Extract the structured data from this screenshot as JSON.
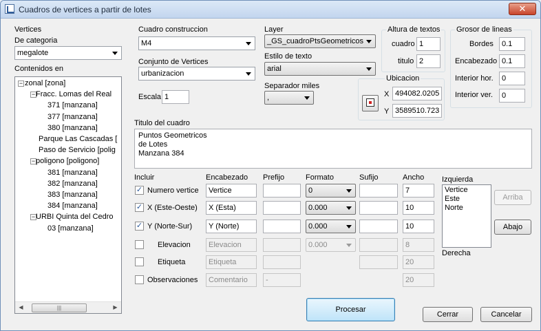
{
  "window": {
    "title": "Cuadros de vertices a partir de lotes",
    "close": "✕"
  },
  "vertices": {
    "group": "Vertices",
    "category_label": "De categoria",
    "category_value": "megalote",
    "contents_label": "Contenidos en",
    "tree": [
      {
        "text": "zonal [zona]",
        "exp": "−"
      },
      {
        "text": "Fracc. Lomas del Real",
        "exp": "−"
      },
      {
        "text": "371 [manzana]"
      },
      {
        "text": "377 [manzana]"
      },
      {
        "text": "380 [manzana]"
      },
      {
        "text": "Parque Las Cascadas ["
      },
      {
        "text": "Paso de Servicio [polig"
      },
      {
        "text": "poligono [poligono]",
        "exp": "−"
      },
      {
        "text": "381 [manzana]"
      },
      {
        "text": "382 [manzana]"
      },
      {
        "text": "383 [manzana]"
      },
      {
        "text": "384 [manzana]"
      },
      {
        "text": "URBI Quinta del Cedro",
        "exp": "−"
      },
      {
        "text": "03 [manzana]"
      }
    ]
  },
  "construction": {
    "label": "Cuadro construccion",
    "value": "M4",
    "conjunto_label": "Conjunto de Vertices",
    "conjunto_value": "urbanizacion",
    "escala_label": "Escala",
    "escala_value": "1"
  },
  "layer": {
    "label": "Layer",
    "value": "_GS_cuadroPtsGeometricos",
    "estilo_label": "Estilo de texto",
    "estilo_value": "arial",
    "separador_label": "Separador miles",
    "separador_value": ","
  },
  "altura": {
    "group": "Altura de textos",
    "cuadro_label": "cuadro",
    "cuadro_value": "1",
    "titulo_label": "titulo",
    "titulo_value": "2"
  },
  "grosor": {
    "group": "Grosor de lineas",
    "bordes_label": "Bordes",
    "bordes_value": "0.1",
    "encabezado_label": "Encabezado",
    "encabezado_value": "0.1",
    "interior_hor_label": "Interior hor.",
    "interior_hor_value": "0",
    "interior_ver_label": "Interior ver.",
    "interior_ver_value": "0"
  },
  "ubicacion": {
    "group": "Ubicacion",
    "x_label": "X",
    "x_value": "494082.0205",
    "y_label": "Y",
    "y_value": "3589510.723"
  },
  "titulo": {
    "label": "Titulo del cuadro",
    "lines": [
      "Puntos Geometricos",
      "de Lotes",
      "Manzana 384"
    ]
  },
  "columns": {
    "incluir": "Incluir",
    "encabezado": "Encabezado",
    "prefijo": "Prefijo",
    "formato": "Formato",
    "sufijo": "Sufijo",
    "ancho": "Ancho"
  },
  "rows": [
    {
      "label": "Numero vertice",
      "checked": "✓",
      "encabezado": "Vertice",
      "prefijo": "",
      "formato": "0",
      "sufijo": "",
      "ancho": "7"
    },
    {
      "label": "X (Este-Oeste)",
      "checked": "✓",
      "encabezado": "X (Esta)",
      "prefijo": "",
      "formato": "0.000",
      "sufijo": "",
      "ancho": "10"
    },
    {
      "label": "Y (Norte-Sur)",
      "checked": "✓",
      "encabezado": "Y (Norte)",
      "prefijo": "",
      "formato": "0.000",
      "sufijo": "",
      "ancho": "10"
    },
    {
      "label": "Elevacion",
      "checked": "",
      "encabezado": "Elevacion",
      "prefijo": "",
      "formato": "0.000",
      "sufijo": "",
      "ancho": "8"
    },
    {
      "label": "Etiqueta",
      "checked": "",
      "encabezado": "Etiqueta",
      "prefijo": "",
      "formato": "",
      "sufijo": "",
      "ancho": "20"
    },
    {
      "label": "Observaciones",
      "checked": "",
      "encabezado": "Comentario",
      "prefijo": "-",
      "formato": "",
      "sufijo": "",
      "ancho": "20"
    }
  ],
  "order": {
    "izquierda_label": "Izquierda",
    "items": [
      "Vertice",
      "Este",
      "Norte"
    ],
    "derecha_label": "Derecha",
    "arriba": "Arriba",
    "abajo": "Abajo"
  },
  "actions": {
    "procesar": "Procesar",
    "cerrar": "Cerrar",
    "cancelar": "Cancelar"
  },
  "scroll": {
    "left": "◀",
    "right": "▶",
    "grip": "|||"
  }
}
